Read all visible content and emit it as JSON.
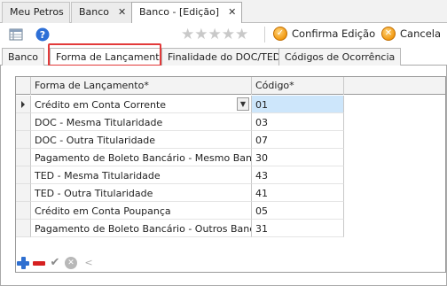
{
  "doc_tabs": [
    {
      "label": "Meu Petros",
      "closable": false
    },
    {
      "label": "Banco",
      "closable": true
    },
    {
      "label": "Banco - [Edição]",
      "closable": true
    }
  ],
  "toolbar": {
    "confirm_label": "Confirma Edição",
    "cancel_label": "Cancela",
    "stars": "★★★★★",
    "icons": [
      "grid-view-icon",
      "help-icon",
      "rating-stars",
      "confirm-icon",
      "cancel-icon"
    ]
  },
  "inner_tabs": [
    {
      "label": "Banco"
    },
    {
      "label": "Forma de Lançamento"
    },
    {
      "label": "Finalidade do DOC/TED"
    },
    {
      "label": "Códigos de Ocorrência"
    }
  ],
  "grid": {
    "columns": [
      "Forma de Lançamento*",
      "Código*"
    ],
    "rows": [
      {
        "forma": "Crédito em Conta Corrente",
        "codigo": "01"
      },
      {
        "forma": "DOC - Mesma Titularidade",
        "codigo": "03"
      },
      {
        "forma": "DOC - Outra Titularidade",
        "codigo": "07"
      },
      {
        "forma": "Pagamento de Boleto Bancário - Mesmo Banco",
        "codigo": "30"
      },
      {
        "forma": "TED - Mesma Titularidade",
        "codigo": "43"
      },
      {
        "forma": "TED - Outra Titularidade",
        "codigo": "41"
      },
      {
        "forma": "Crédito em Conta Poupança",
        "codigo": "05"
      },
      {
        "forma": "Pagamento de Boleto Bancário - Outros Bancos",
        "codigo": "31"
      }
    ]
  },
  "colors": {
    "accent_orange": "#f29a12",
    "highlight_red": "#e23a3a",
    "selection_blue": "#cde6fb",
    "add_blue": "#2f6fd0",
    "remove_red": "#d62020"
  }
}
